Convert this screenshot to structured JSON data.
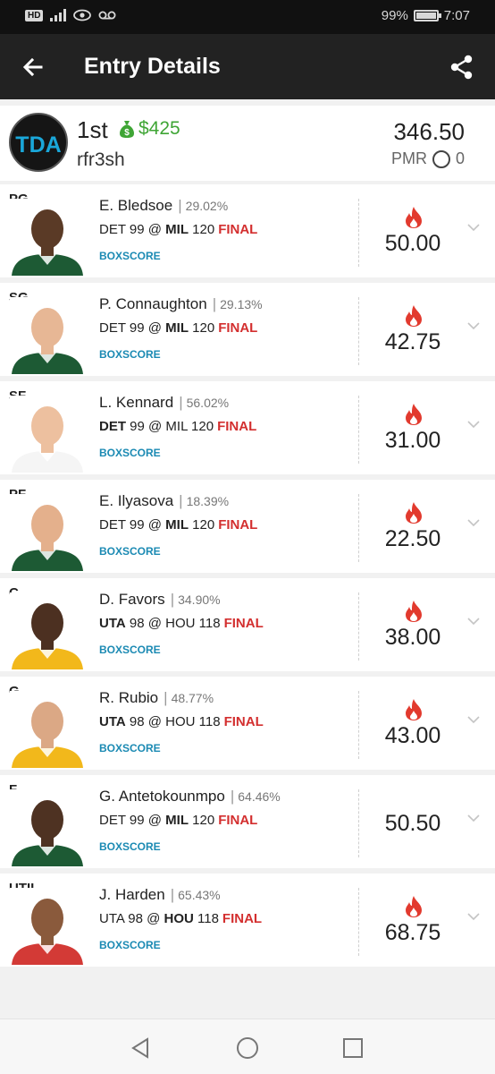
{
  "status_bar": {
    "left_badge": "HD",
    "battery": "99%",
    "battery_level": 0.99,
    "time": "7:07"
  },
  "app_bar": {
    "title": "Entry Details",
    "back_icon": "arrow-left-icon",
    "share_icon": "share-icon"
  },
  "entry": {
    "logo_text": "TDA",
    "rank": "1st",
    "prize": "$425",
    "username": "rfr3sh",
    "total_points": "346.50",
    "pmr_label": "PMR",
    "pmr_value": "0"
  },
  "players": [
    {
      "position": "PG",
      "name": "E. Bledsoe",
      "ownership": "29.02%",
      "away_team": "DET",
      "away_score": "99",
      "home_team": "MIL",
      "home_score": "120",
      "bold_team": "home",
      "status": "FINAL",
      "boxscore": "BOXSCORE",
      "points": "50.00",
      "on_fire": true,
      "jersey_color": "#1d5a34",
      "skin_color": "#5a3a26"
    },
    {
      "position": "SG",
      "name": "P. Connaughton",
      "ownership": "29.13%",
      "away_team": "DET",
      "away_score": "99",
      "home_team": "MIL",
      "home_score": "120",
      "bold_team": "home",
      "status": "FINAL",
      "boxscore": "BOXSCORE",
      "points": "42.75",
      "on_fire": true,
      "jersey_color": "#1d5a34",
      "skin_color": "#e7b795"
    },
    {
      "position": "SF",
      "name": "L. Kennard",
      "ownership": "56.02%",
      "away_team": "DET",
      "away_score": "99",
      "home_team": "MIL",
      "home_score": "120",
      "bold_team": "away",
      "status": "FINAL",
      "boxscore": "BOXSCORE",
      "points": "31.00",
      "on_fire": true,
      "jersey_color": "#f5f5f5",
      "skin_color": "#edc09f"
    },
    {
      "position": "PF",
      "name": "E. Ilyasova",
      "ownership": "18.39%",
      "away_team": "DET",
      "away_score": "99",
      "home_team": "MIL",
      "home_score": "120",
      "bold_team": "home",
      "status": "FINAL",
      "boxscore": "BOXSCORE",
      "points": "22.50",
      "on_fire": true,
      "jersey_color": "#1d5a34",
      "skin_color": "#e4b08c"
    },
    {
      "position": "C",
      "name": "D. Favors",
      "ownership": "34.90%",
      "away_team": "UTA",
      "away_score": "98",
      "home_team": "HOU",
      "home_score": "118",
      "bold_team": "away",
      "status": "FINAL",
      "boxscore": "BOXSCORE",
      "points": "38.00",
      "on_fire": true,
      "jersey_color": "#f2b81b",
      "skin_color": "#4c3021"
    },
    {
      "position": "G",
      "name": "R. Rubio",
      "ownership": "48.77%",
      "away_team": "UTA",
      "away_score": "98",
      "home_team": "HOU",
      "home_score": "118",
      "bold_team": "away",
      "status": "FINAL",
      "boxscore": "BOXSCORE",
      "points": "43.00",
      "on_fire": true,
      "jersey_color": "#f2b81b",
      "skin_color": "#dba885"
    },
    {
      "position": "F",
      "name": "G. Antetokounmpo",
      "ownership": "64.46%",
      "away_team": "DET",
      "away_score": "99",
      "home_team": "MIL",
      "home_score": "120",
      "bold_team": "home",
      "status": "FINAL",
      "boxscore": "BOXSCORE",
      "points": "50.50",
      "on_fire": false,
      "jersey_color": "#1d5a34",
      "skin_color": "#4e3222"
    },
    {
      "position": "UTIL",
      "name": "J. Harden",
      "ownership": "65.43%",
      "away_team": "UTA",
      "away_score": "98",
      "home_team": "HOU",
      "home_score": "118",
      "bold_team": "home",
      "status": "FINAL",
      "boxscore": "BOXSCORE",
      "points": "68.75",
      "on_fire": true,
      "jersey_color": "#d33a36",
      "skin_color": "#8a5a3c"
    }
  ],
  "nav_bar": {
    "back_icon": "triangle-back-icon",
    "home_icon": "circle-home-icon",
    "recents_icon": "square-recents-icon"
  },
  "colors": {
    "accent_green": "#3fa535",
    "final_red": "#d32f2f",
    "boxscore_blue": "#1b8ab3",
    "fire_red": "#e23a2e"
  }
}
